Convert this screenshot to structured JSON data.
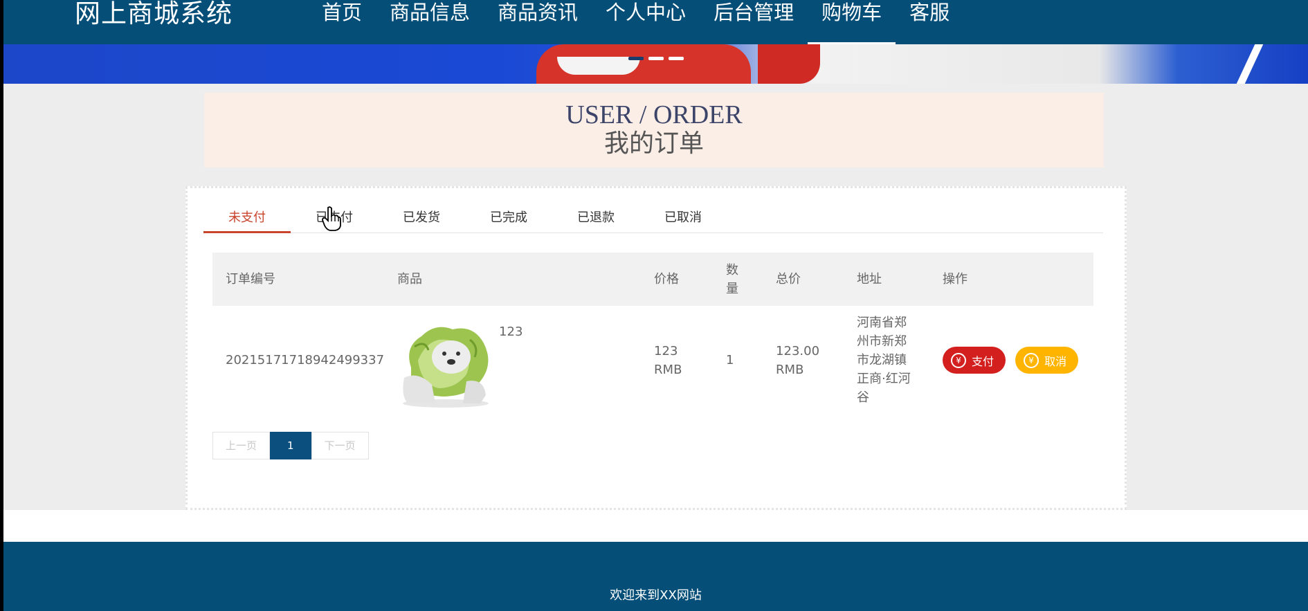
{
  "header": {
    "brand": "网上商城系统",
    "nav": [
      "首页",
      "商品信息",
      "商品资讯",
      "个人中心",
      "后台管理",
      "购物车",
      "客服"
    ],
    "active_nav": "购物车"
  },
  "page_title": {
    "en": "USER / ORDER",
    "zh": "我的订单"
  },
  "tabs": [
    "未支付",
    "已支付",
    "已发货",
    "已完成",
    "已退款",
    "已取消"
  ],
  "active_tab": "未支付",
  "table": {
    "headers": {
      "order_no": "订单编号",
      "goods": "商品",
      "price": "价格",
      "qty": "数量",
      "total": "总价",
      "address": "地址",
      "ops": "操作"
    },
    "rows": [
      {
        "order_no": "20215171718942499337",
        "goods_name": "123",
        "price": "123 RMB",
        "qty": "1",
        "total": "123.00 RMB",
        "address": "河南省郑州市新郑市龙湖镇正商·红河谷"
      }
    ],
    "actions": {
      "pay": "支付",
      "cancel": "取消",
      "icon": "¥"
    }
  },
  "pager": {
    "prev": "上一页",
    "current": "1",
    "next": "下一页"
  },
  "footer": {
    "text": "欢迎来到XX网站"
  },
  "colors": {
    "primary": "#044e78",
    "active_tab": "#c9442c",
    "pay": "#d41f1f",
    "cancel": "#ffb400"
  }
}
